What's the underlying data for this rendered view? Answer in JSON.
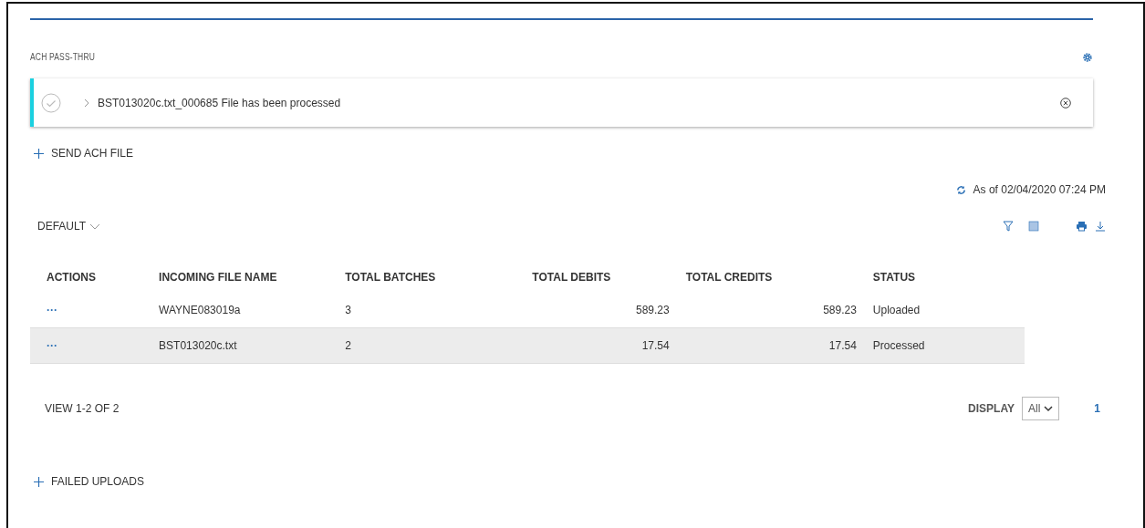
{
  "section": {
    "title": "ACH PASS-THRU"
  },
  "notification": {
    "message": "BST013020c.txt_000685 File has been processed"
  },
  "send_action": {
    "label": "SEND ACH FILE"
  },
  "as_of": {
    "text": "As of 02/04/2020 07:24 PM"
  },
  "view_menu": {
    "label": "DEFAULT"
  },
  "table": {
    "columns": [
      {
        "label": "ACTIONS"
      },
      {
        "label": "INCOMING FILE NAME"
      },
      {
        "label": "TOTAL BATCHES"
      },
      {
        "label": "TOTAL DEBITS"
      },
      {
        "label": "TOTAL CREDITS"
      },
      {
        "label": "STATUS"
      }
    ],
    "rows": [
      {
        "actions": "···",
        "file_name": "WAYNE083019a",
        "total_batches": "3",
        "total_debits": "589.23",
        "total_credits": "589.23",
        "status": "Uploaded",
        "selected": false
      },
      {
        "actions": "···",
        "file_name": "BST013020c.txt",
        "total_batches": "2",
        "total_debits": "17.54",
        "total_credits": "17.54",
        "status": "Processed",
        "selected": true
      }
    ]
  },
  "pagination": {
    "summary": "VIEW 1-2 OF 2",
    "display_label": "DISPLAY",
    "display_value": "All",
    "pages": [
      {
        "label": "1",
        "selected": true
      }
    ]
  },
  "failed_action": {
    "label": "FAILED UPLOADS"
  }
}
